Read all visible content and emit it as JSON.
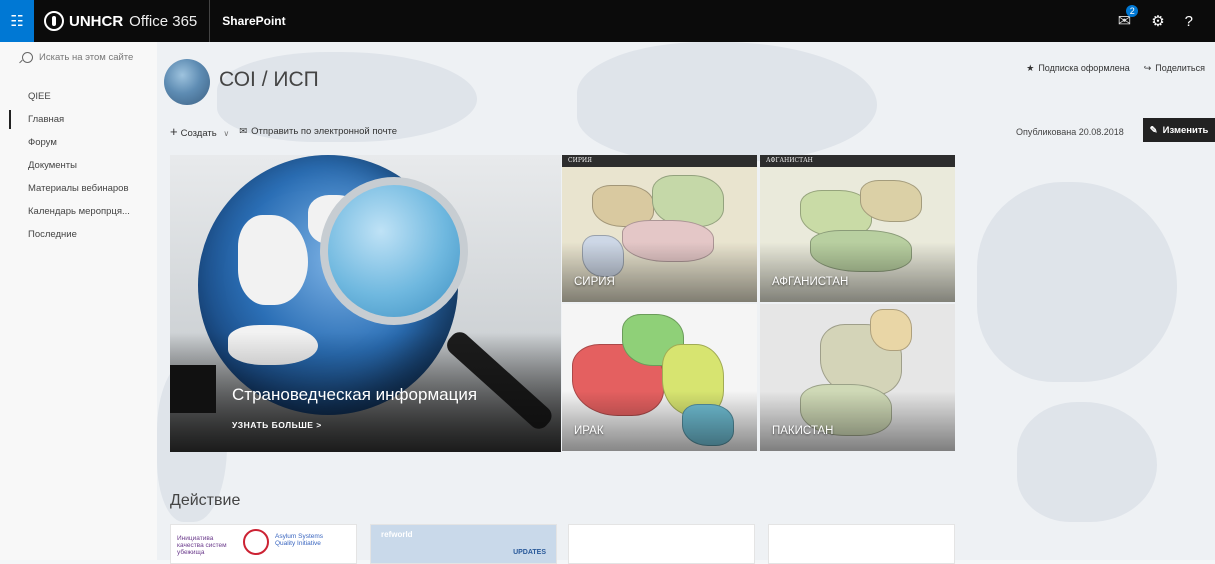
{
  "suitebar": {
    "brand_name": "UNHCR",
    "office_label": "Office 365",
    "app_name": "SharePoint",
    "notification_count": "2",
    "help_label": "?"
  },
  "leftnav": {
    "search_placeholder": "Искать на этом сайте",
    "items": [
      {
        "label": "QIEE"
      },
      {
        "label": "Главная"
      },
      {
        "label": "Форум"
      },
      {
        "label": "Документы"
      },
      {
        "label": "Материалы вебинаров"
      },
      {
        "label": "Календарь меропрця..."
      },
      {
        "label": "Последние"
      }
    ]
  },
  "header": {
    "site_title": "СОI / ИСП",
    "follow_label": "Подписка оформлена",
    "share_label": "Поделиться"
  },
  "commandbar": {
    "new_label": "Создать",
    "email_label": "Отправить по электронной почте",
    "published_label": "Опубликована 20.08.2018",
    "edit_label": "Изменить"
  },
  "hero": {
    "main_caption": "Страноведческая информация",
    "main_link": "УЗНАТЬ БОЛЬШЕ >",
    "tiles": [
      {
        "label": "СИРИЯ",
        "header": "СИРИЯ"
      },
      {
        "label": "АФГАНИСТАН",
        "header": "АФГАНИСТАН"
      },
      {
        "label": "ИРАК"
      },
      {
        "label": "ПАКИСТАН"
      }
    ]
  },
  "actions": {
    "title": "Действие",
    "cards": [
      {
        "left_text": "Инициатива качества систем убежища",
        "right_text": "Asylum Systems Quality Initiative"
      },
      {
        "brand": "refworld",
        "badge": "UPDATES"
      }
    ]
  },
  "colors": {
    "suitebar": "#0b0b0b",
    "waffle": "#0078d4",
    "edit_button": "#222222"
  }
}
